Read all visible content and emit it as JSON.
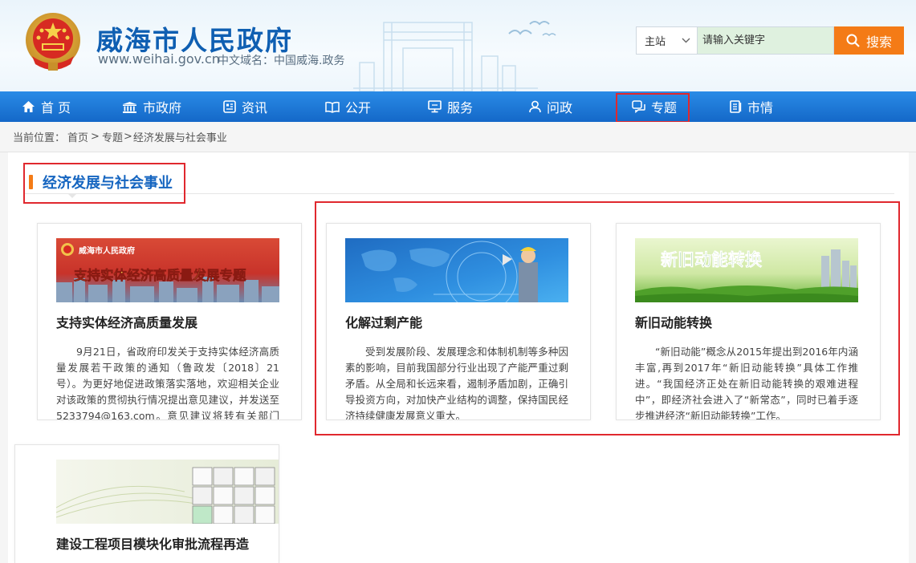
{
  "header": {
    "title": "威海市人民政府",
    "domain": "www.weihai.gov.cn",
    "cn_domain": "中文域名：中国威海.政务"
  },
  "search": {
    "scope": "主站",
    "placeholder": "请输入关键字",
    "button_label": "搜索"
  },
  "nav": {
    "items": [
      {
        "label": "首 页",
        "icon": "home-icon"
      },
      {
        "label": "市政府",
        "icon": "building-icon"
      },
      {
        "label": "资讯",
        "icon": "news-icon"
      },
      {
        "label": "公开",
        "icon": "book-icon"
      },
      {
        "label": "服务",
        "icon": "monitor-icon"
      },
      {
        "label": "问政",
        "icon": "user-icon"
      },
      {
        "label": "专题",
        "icon": "chat-icon"
      },
      {
        "label": "市情",
        "icon": "document-icon"
      }
    ]
  },
  "breadcrumb": {
    "prefix": "当前位置：",
    "home": "首页",
    "sep1": ">",
    "topics": "专题",
    "sep2": ">",
    "current": "经济发展与社会事业"
  },
  "section": {
    "title": "经济发展与社会事业"
  },
  "cards": [
    {
      "title": "支持实体经济高质量发展",
      "banner_header": "威海市人民政府",
      "banner_text": "支持实体经济高质量发展专题",
      "desc": "9月21日，省政府印发关于支持实体经济高质量发展若干政策的通知（鲁政发〔2018〕21号）。为更好地促进政策落实落地，欢迎相关企业对该政策的贯彻执行情况提出意见建议，并发送至5233794@163.com。意见建议将转有关部门（单位）研究。"
    },
    {
      "title": "化解过剩产能",
      "desc": "受到发展阶段、发展理念和体制机制等多种因素的影响，目前我国部分行业出现了产能严重过剩矛盾。从全局和长远来看，遏制矛盾加剧，正确引导投资方向，对加快产业结构的调整，保持国民经济持续健康发展意义重大。"
    },
    {
      "title": "新旧动能转换",
      "banner_text": "新旧动能转换",
      "desc": "“新旧动能”概念从2015年提出到2016年内涵丰富,再到2017年“新旧动能转换”具体工作推进。“我国经济正处在新旧动能转换的艰难进程中”，即经济社会进入了“新常态”，同时已着手逐步推进经济“新旧动能转换”工作。"
    },
    {
      "title": "建设工程项目模块化审批流程再造"
    }
  ],
  "colors": {
    "brand_blue": "#1565c0",
    "nav_blue": "#1b74d4",
    "search_orange": "#f47b16",
    "highlight_red": "#e0282e"
  }
}
